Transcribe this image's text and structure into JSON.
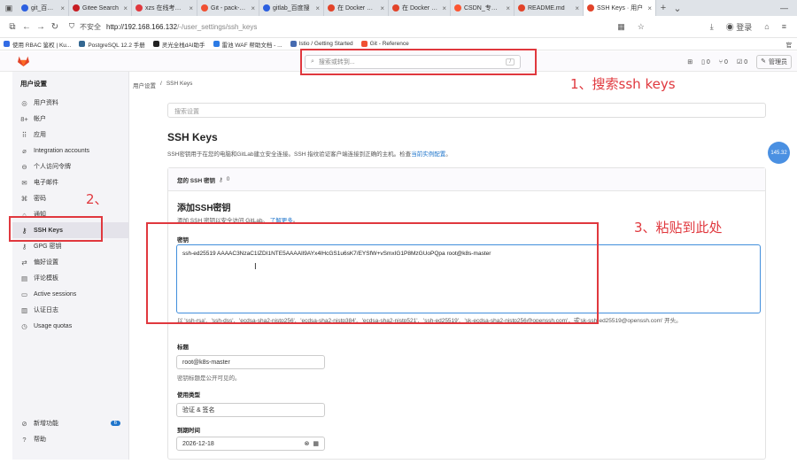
{
  "browser": {
    "tabs": [
      {
        "title": "git_百度搜索",
        "color": "#2b5fe0"
      },
      {
        "title": "Gitee Search",
        "color": "#c71d23"
      },
      {
        "title": "xzs 在线考试系",
        "color": "#e0383e"
      },
      {
        "title": "Git - pack-heu",
        "color": "#f05032"
      },
      {
        "title": "gitlab_百度搜",
        "color": "#2b5fe0"
      },
      {
        "title": "在 Docker 容器",
        "color": "#e24329"
      },
      {
        "title": "在 Docker 容器",
        "color": "#e24329"
      },
      {
        "title": "CSDN_专业开",
        "color": "#fc5531"
      },
      {
        "title": "README.md",
        "color": "#e24329"
      },
      {
        "title": "SSH Keys · 用户",
        "color": "#e24329",
        "active": true
      }
    ],
    "tab_close": "×",
    "new_tab": "+",
    "dropdown": "⌄",
    "minimize": "—",
    "nav": {
      "back": "←",
      "forward": "→",
      "reload": "↻"
    },
    "address": {
      "insecure_label": "不安全",
      "host": "http://192.168.166.132",
      "path": "/-/user_settings/ssh_keys"
    },
    "addr_right": {
      "login_label": "登录"
    },
    "bookmarks": [
      {
        "label": "使用 RBAC 鉴权 | Ku...",
        "color": "#326ce5"
      },
      {
        "label": "PostgreSQL 12.2 手册",
        "color": "#336791"
      },
      {
        "label": "灵光全栈dAI助手",
        "color": "#222"
      },
      {
        "label": "雷池 WAF 帮助文档 - ...",
        "color": "#2c7be5"
      },
      {
        "label": "Istio / Getting Started",
        "color": "#466bb0"
      },
      {
        "label": "Git - Reference",
        "color": "#f05032"
      }
    ],
    "bookmarks_overflow": "官"
  },
  "header": {
    "search_placeholder": "搜索或转到...",
    "search_shortcut": "/",
    "issues_count": "0",
    "mr_count": "0",
    "todo_count": "0",
    "admin_label": "管理员"
  },
  "sidebar": {
    "title": "用户设置",
    "items": [
      {
        "icon": "◎",
        "label": "用户资料"
      },
      {
        "icon": "8+",
        "label": "帐户"
      },
      {
        "icon": "⠿",
        "label": "应用"
      },
      {
        "icon": "⌀",
        "label": "Integration accounts"
      },
      {
        "icon": "⊖",
        "label": "个人访问令牌"
      },
      {
        "icon": "✉",
        "label": "电子邮件"
      },
      {
        "icon": "⌘",
        "label": "密码"
      },
      {
        "icon": "⌂",
        "label": "通知"
      },
      {
        "icon": "⚷",
        "label": "SSH Keys",
        "active": true
      },
      {
        "icon": "⚷",
        "label": "GPG 密钥"
      },
      {
        "icon": "⇄",
        "label": "偏好设置"
      },
      {
        "icon": "▤",
        "label": "评论模板"
      },
      {
        "icon": "▭",
        "label": "Active sessions"
      },
      {
        "icon": "▥",
        "label": "认证日志"
      },
      {
        "icon": "◷",
        "label": "Usage quotas"
      }
    ],
    "bottom": [
      {
        "icon": "⊘",
        "label": "新增功能",
        "badge": "6"
      },
      {
        "icon": "?",
        "label": "帮助"
      }
    ]
  },
  "main": {
    "breadcrumb": [
      "用户设置",
      "/",
      "SSH Keys"
    ],
    "search_settings_placeholder": "搜索设置",
    "title": "SSH Keys",
    "description": "SSH密钥用于在您的电脑和GitLab建立安全连接。SSH 指纹验证客户端连接到正确的主机。检查",
    "description_link": "当前实例配置",
    "description_end": "。",
    "keys_card": {
      "heading": "您的 SSH 密钥",
      "count": "0",
      "add_title": "添加SSH密钥",
      "add_desc": "添加 SSH 密钥以安全访问 GitLab。",
      "add_link": "了解更多",
      "add_end": "。",
      "key_label": "密钥",
      "key_value": "ssh-ed25519 AAAAC3NzaC1lZDI1NTE5AAAAIl9AYx4lHcGS1u6sK7/EYSfW+vSmxIG1P8MzGUoPQpa root@k8s-master",
      "key_help": "以 'ssh-rsa'、'ssh-dss'、'ecdsa-sha2-nistp256'、'ecdsa-sha2-nistp384'、'ecdsa-sha2-nistp521'、'ssh-ed25519'、'sk-ecdsa-sha2-nistp256@openssh.com'，或'sk-ssh-ed25519@openssh.com' 开头。",
      "title_label": "标题",
      "title_value": "root@k8s-master",
      "title_help": "密钥标题是公开可见的。",
      "usage_label": "使用类型",
      "usage_value": "验证 & 签名",
      "expires_label": "到期时间",
      "expires_value": "2026-12-18"
    }
  },
  "annotations": {
    "step1": "1、搜索ssh keys",
    "step2": "2、",
    "step3": "3、粘贴到此处",
    "color": "#e0383e"
  },
  "floating_badge": "145.32"
}
